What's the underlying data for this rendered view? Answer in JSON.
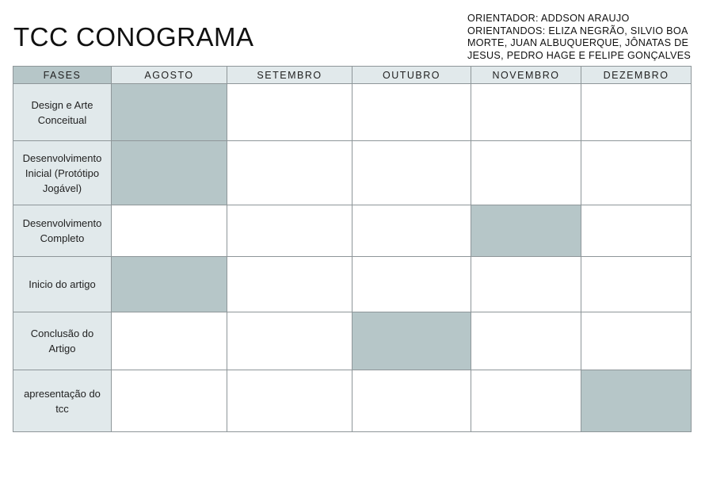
{
  "title": "TCC CONOGRAMA",
  "orientador": "ORIENTADOR: ADDSON ARAUJO",
  "orientandos": "ORIENTANDOS:  ELIZA NEGRÃO, SILVIO BOA MORTE, JUAN ALBUQUERQUE, JÔNATAS DE JESUS, PEDRO HAGE E FELIPE GONÇALVES",
  "colors": {
    "fill": "#b6c6c8",
    "header": "#e1e9eb"
  },
  "table": {
    "phase_header": "FASES",
    "months": [
      "AGOSTO",
      "SETEMBRO",
      "OUTUBRO",
      "NOVEMBRO",
      "DEZEMBRO"
    ],
    "rows": [
      {
        "phase": "Design e Arte\nConceitual",
        "active_month": "AGOSTO"
      },
      {
        "phase": "Desenvolvimento\nInicial (Protótipo\nJogável)",
        "active_month": "AGOSTO"
      },
      {
        "phase": "Desenvolvimento\nCompleto",
        "active_month": "NOVEMBRO"
      },
      {
        "phase": "Inicio do artigo",
        "active_month": "AGOSTO"
      },
      {
        "phase": "Conclusão do\nArtigo",
        "active_month": "OUTUBRO"
      },
      {
        "phase": "apresentação do\ntcc",
        "active_month": "DEZEMBRO"
      }
    ]
  }
}
